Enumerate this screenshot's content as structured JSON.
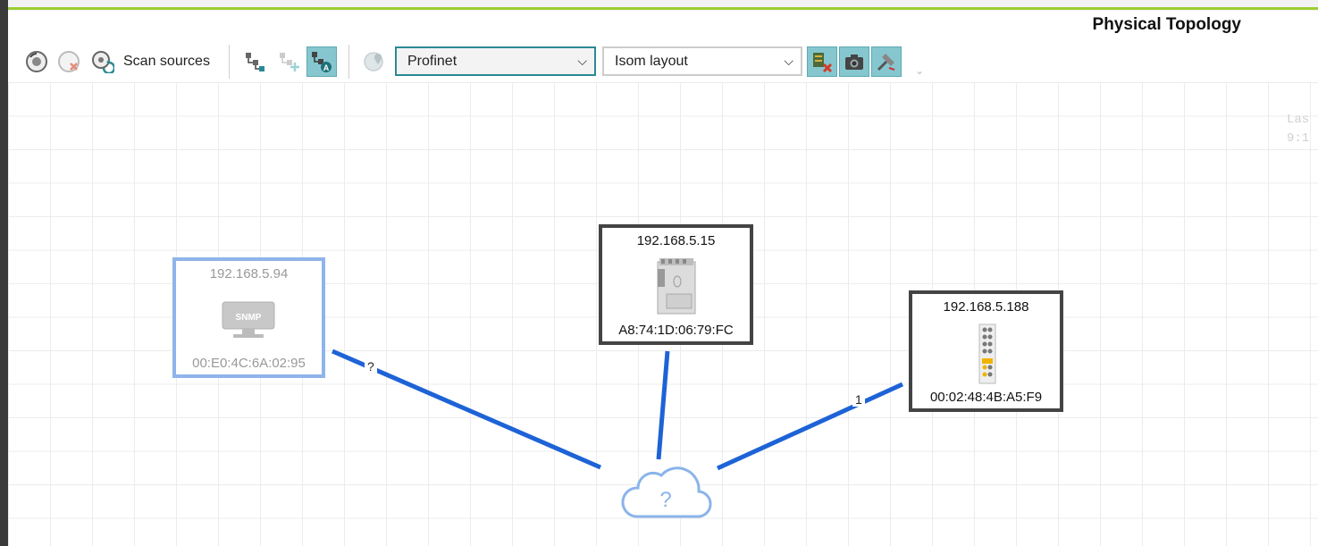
{
  "header": {
    "title": "Physical Topology"
  },
  "toolbar": {
    "scan_label": "Scan sources",
    "protocol": {
      "selected": "Profinet"
    },
    "layout": {
      "selected": "Isom layout"
    }
  },
  "overlay": {
    "last_text_line1": "Las",
    "last_text_line2": "9:1"
  },
  "nodes": [
    {
      "ip": "192.168.5.94",
      "mac": "00:E0:4C:6A:02:95",
      "icon": "snmp-monitor-icon",
      "badge": "SNMP"
    },
    {
      "ip": "192.168.5.15",
      "mac": "A8:74:1D:06:79:FC",
      "icon": "controller-device-icon"
    },
    {
      "ip": "192.168.5.188",
      "mac": "00:02:48:4B:A5:F9",
      "icon": "io-module-device-icon"
    }
  ],
  "links": [
    {
      "label": "?"
    },
    {
      "label": ""
    },
    {
      "label": "1"
    }
  ],
  "cloud": {
    "label": "?"
  },
  "colors": {
    "accent": "#9acd32",
    "link": "#1e63d6",
    "active_button": "#86c7cf",
    "snmp_border": "#8fb4ea"
  }
}
